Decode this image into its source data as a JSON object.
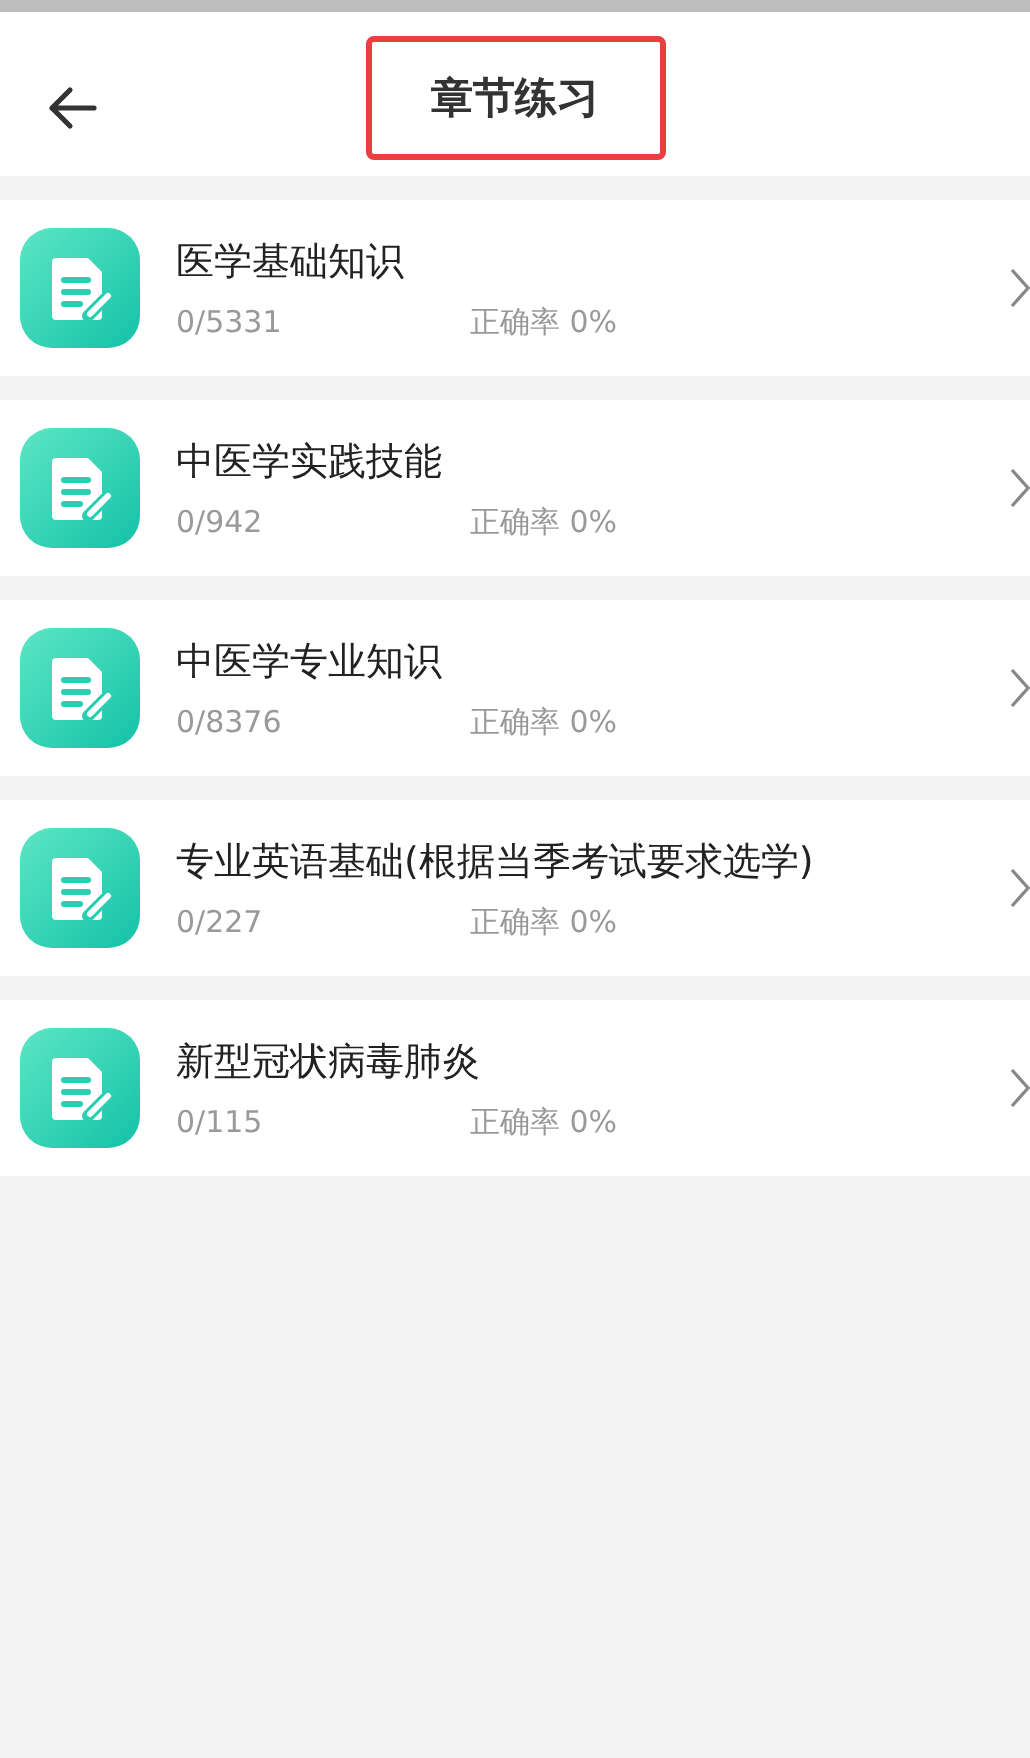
{
  "header": {
    "title": "章节练习",
    "title_highlighted": true
  },
  "chapters": [
    {
      "name": "医学基础知识",
      "progress": "0/5331",
      "accuracy": "正确率 0%"
    },
    {
      "name": "中医学实践技能",
      "progress": "0/942",
      "accuracy": "正确率 0%"
    },
    {
      "name": "中医学专业知识",
      "progress": "0/8376",
      "accuracy": "正确率 0%"
    },
    {
      "name": "专业英语基础(根据当季考试要求选学)",
      "progress": "0/227",
      "accuracy": "正确率 0%"
    },
    {
      "name": "新型冠状病毒肺炎",
      "progress": "0/115",
      "accuracy": "正确率 0%"
    }
  ]
}
